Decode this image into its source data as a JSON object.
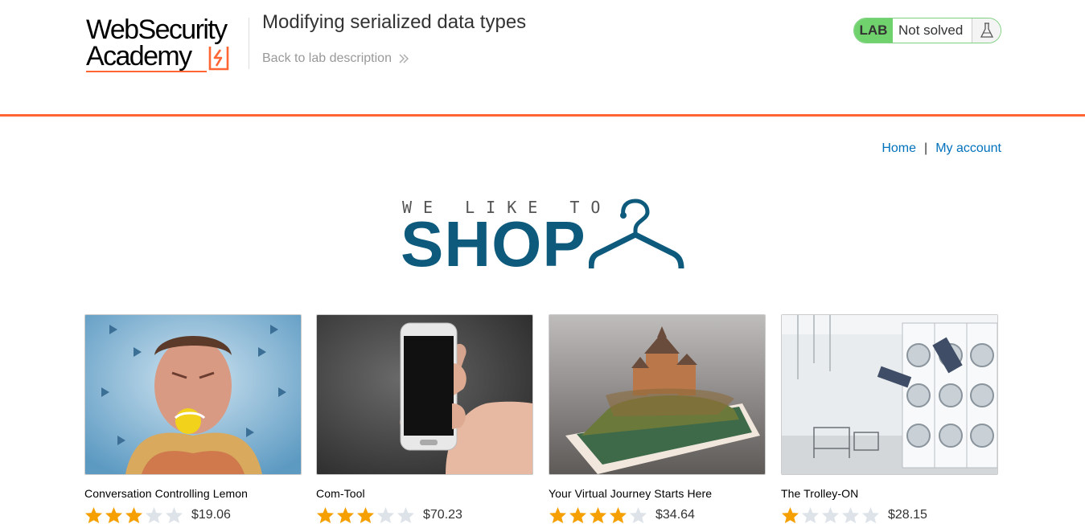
{
  "academy": {
    "logo_line1": "WebSecurity",
    "logo_line2": "Academy",
    "lab_title": "Modifying serialized data types",
    "back_link": "Back to lab description",
    "lab_badge": "LAB",
    "lab_status": "Not solved"
  },
  "nav": {
    "home": "Home",
    "separator": "|",
    "my_account": "My account"
  },
  "hero": {
    "tagline": "WE LIKE TO",
    "headline": "SHOP"
  },
  "colors": {
    "accent_orange": "#ff6633",
    "link_blue": "#0071bc",
    "shop_blue": "#0d5a7c",
    "lab_green": "#70d26c",
    "star_gold": "#f5a000",
    "star_grey": "#dde3e8"
  },
  "products": [
    {
      "name": "Conversation Controlling Lemon",
      "rating": 3,
      "price": "$19.06",
      "image": "man-biting-lemon"
    },
    {
      "name": "Com-Tool",
      "rating": 3,
      "price": "$70.23",
      "image": "hand-holding-phone"
    },
    {
      "name": "Your Virtual Journey Starts Here",
      "rating": 4,
      "price": "$34.64",
      "image": "castle-on-phone"
    },
    {
      "name": "The Trolley-ON",
      "rating": 1,
      "price": "$28.15",
      "image": "laundromat-dive"
    }
  ]
}
